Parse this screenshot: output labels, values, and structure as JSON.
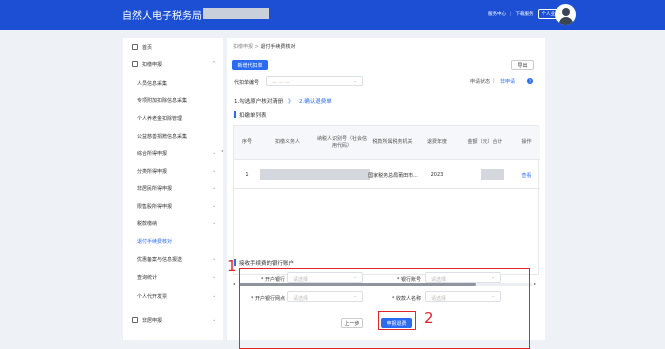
{
  "header": {
    "title": "自然人电子税务局",
    "links": [
      "服务中心",
      "下载服务",
      "个人业务"
    ]
  },
  "sidebar": {
    "items": [
      {
        "label": "首页",
        "icon": "home-icon",
        "level": 0
      },
      {
        "label": "扣缴申报",
        "icon": "document-icon",
        "level": 0,
        "expanded": true
      },
      {
        "label": "人员信息采集",
        "level": 1
      },
      {
        "label": "专项附加扣除信息采集",
        "level": 1
      },
      {
        "label": "个人养老金扣除管理",
        "level": 1
      },
      {
        "label": "公益慈善捐赠信息采集",
        "level": 1
      },
      {
        "label": "综合所得申报",
        "level": 1,
        "expandable": true
      },
      {
        "label": "分类所得申报",
        "level": 1,
        "expandable": true
      },
      {
        "label": "非居民所得申报",
        "level": 1,
        "expandable": true
      },
      {
        "label": "限售股所得申报",
        "level": 1,
        "expandable": true
      },
      {
        "label": "税款缴纳",
        "level": 1,
        "expandable": true
      },
      {
        "label": "退付手续费核对",
        "level": 1,
        "active": true
      },
      {
        "label": "优惠备案与信息报送",
        "level": 1,
        "expandable": true
      },
      {
        "label": "查询统计",
        "level": 1,
        "expandable": true
      },
      {
        "label": "个人代开发票",
        "level": 1,
        "expandable": true
      },
      {
        "label": "非居申报",
        "icon": "document-icon",
        "level": 0,
        "expandable": true
      }
    ]
  },
  "breadcrumb": {
    "parent": "扣缴申报",
    "sep": ">",
    "current": "退付手续费核对"
  },
  "toolbar": {
    "new_button": "新增代扣单",
    "export_button": "导出",
    "status_text": "申请状态",
    "notice_link": "非申请"
  },
  "filter": {
    "label": "代扣单编号",
    "placeholder": "— — —"
  },
  "steps": {
    "step1": "1.勾选原户核对清册",
    "arrow": "》",
    "step2": "2.确认退费单"
  },
  "list_title": "扣缴单列表",
  "table": {
    "headers": [
      "序号",
      "扣缴义务人",
      "纳税人识别号（社会信用代码）",
      "税款所属税务机关",
      "退费年度",
      "金额（元）合计",
      "操作"
    ],
    "rows": [
      {
        "index": "1",
        "agent": "",
        "tax_id": "",
        "authority": "国家税务总局莆田市...",
        "year": "2023",
        "amount": "",
        "action": "查看"
      }
    ]
  },
  "bank_section": {
    "title": "接收手续费的银行账户",
    "fields": [
      {
        "label": "* 开户银行",
        "placeholder": "请选择"
      },
      {
        "label": "* 银行账号",
        "placeholder": "请选择"
      },
      {
        "label": "* 开户银行网点",
        "placeholder": "请选择"
      },
      {
        "label": "* 收款人名称",
        "placeholder": "请选择"
      }
    ]
  },
  "footer": {
    "prev_button": "上一步",
    "submit_button": "申报退费"
  },
  "annotations": [
    "1",
    "2"
  ]
}
